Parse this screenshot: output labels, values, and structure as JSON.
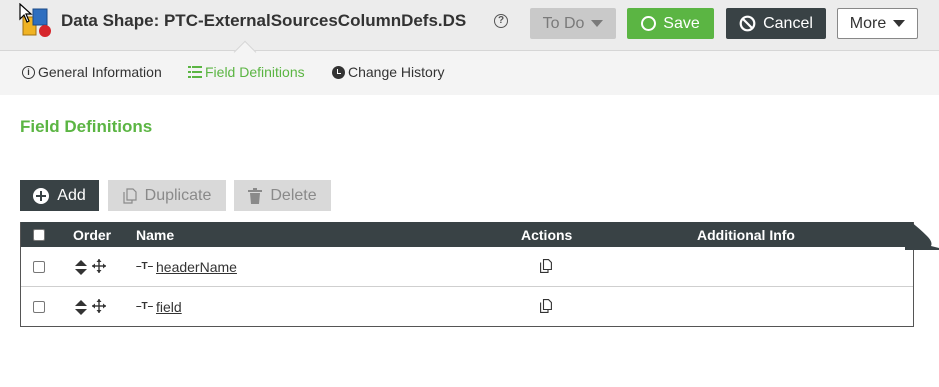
{
  "header": {
    "title": "Data Shape: PTC-ExternalSourcesColumnDefs.DS",
    "help_symbol": "?",
    "todo_label": "To Do",
    "save_label": "Save",
    "cancel_label": "Cancel",
    "more_label": "More"
  },
  "tabs": [
    {
      "label": "General Information",
      "icon": "info-icon",
      "active": false
    },
    {
      "label": "Field Definitions",
      "icon": "list-icon",
      "active": true
    },
    {
      "label": "Change History",
      "icon": "clock-icon",
      "active": false
    }
  ],
  "section": {
    "title": "Field Definitions"
  },
  "actions": {
    "add_label": "Add",
    "duplicate_label": "Duplicate",
    "delete_label": "Delete"
  },
  "grid": {
    "columns": [
      "Order",
      "Name",
      "Actions",
      "Additional Info"
    ],
    "rows": [
      {
        "name": "headerName",
        "type_icon": "string-type-icon",
        "additional_info": ""
      },
      {
        "name": "field",
        "type_icon": "string-type-icon",
        "additional_info": ""
      }
    ]
  },
  "colors": {
    "accent_green": "#5bb543",
    "dark": "#394245"
  }
}
